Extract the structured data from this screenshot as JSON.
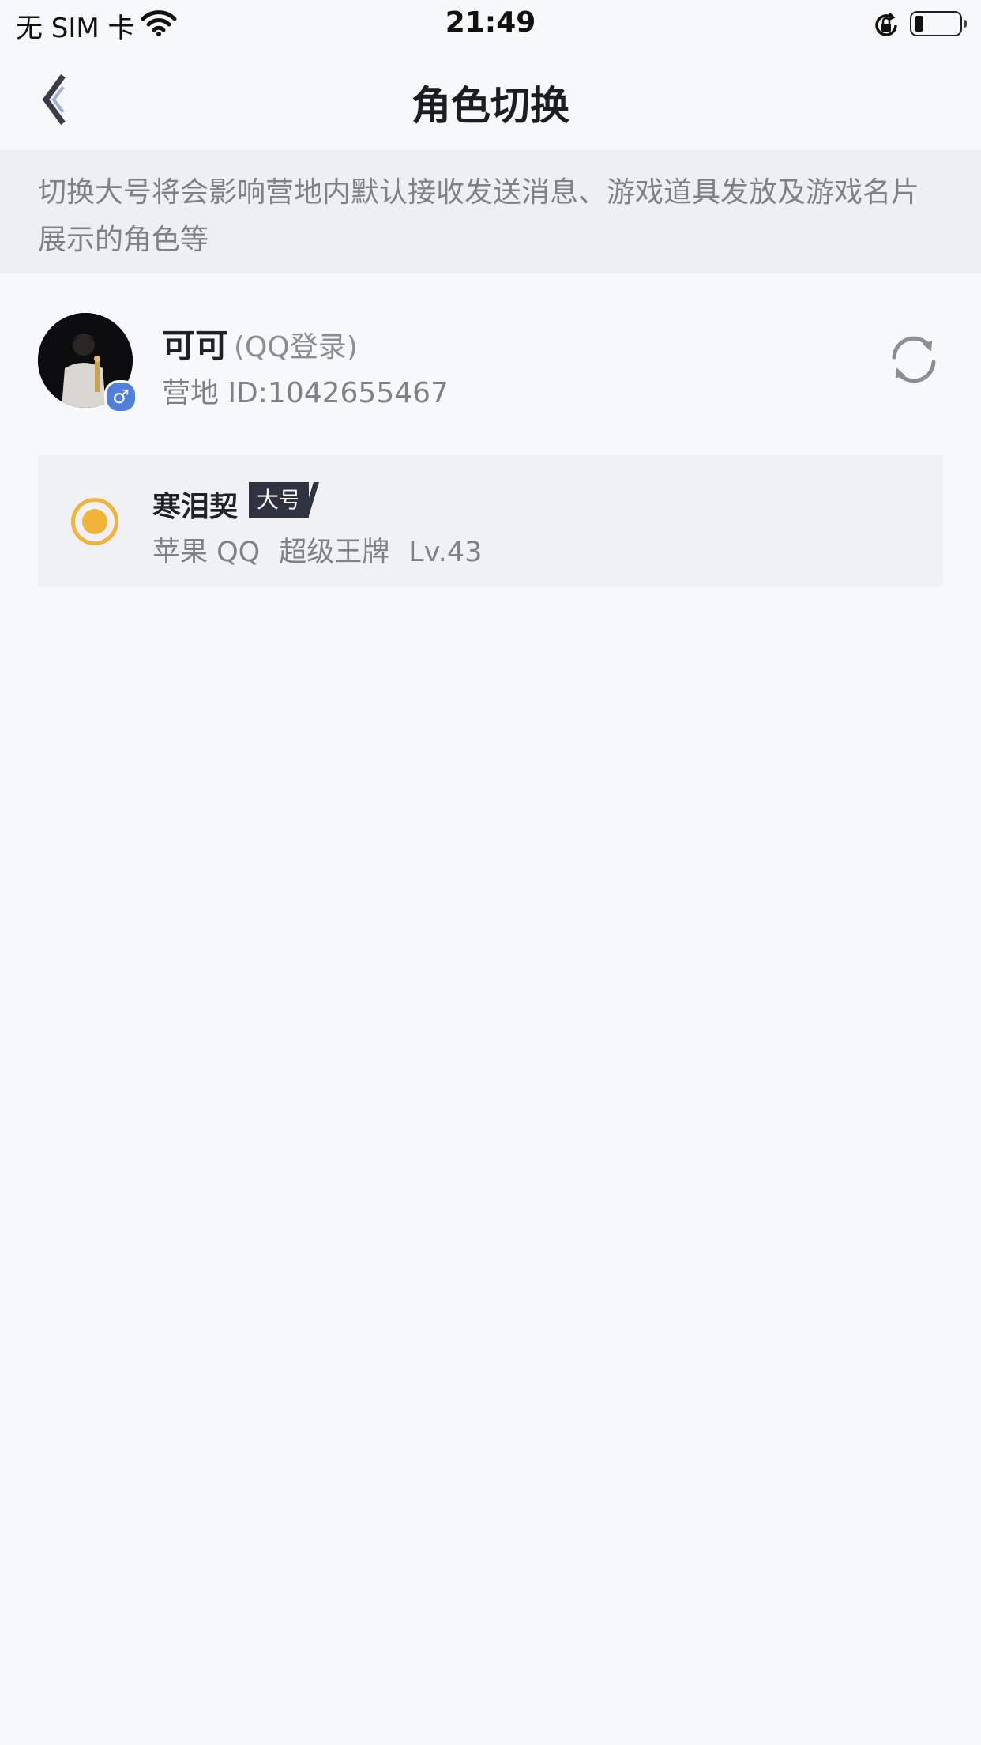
{
  "status_bar": {
    "carrier": "无 SIM 卡",
    "time": "21:49",
    "battery_level": 0.15
  },
  "nav": {
    "title": "角色切换",
    "back_icon": "chevron-left-icon"
  },
  "notice": {
    "text": "切换大号将会影响营地内默认接收发送消息、游戏道具发放及游戏名片展示的角色等"
  },
  "account": {
    "name": "可可",
    "login_type": "(QQ登录)",
    "id_text": "营地 ID:1042655467",
    "gender_symbol": "♂",
    "gender_color": "#4f7fd9",
    "refresh_icon": "refresh-icon"
  },
  "role": {
    "name": "寒泪契",
    "tag": "大号",
    "platform": "苹果 QQ",
    "rank": "超级王牌",
    "level": "Lv.43",
    "selected": true,
    "accent_color": "#f2b33a"
  }
}
